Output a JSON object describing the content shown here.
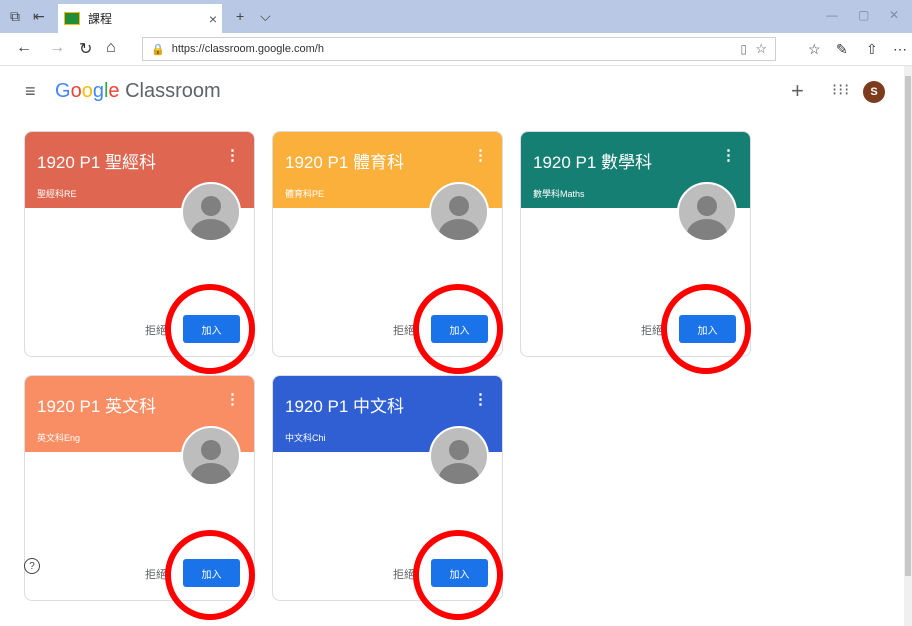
{
  "browser": {
    "tab_title": "課程",
    "url": "https://classroom.google.com/h"
  },
  "app": {
    "logo_google": [
      "G",
      "o",
      "o",
      "g",
      "l",
      "e"
    ],
    "logo_product": "Classroom",
    "avatar_initial": "S"
  },
  "cards": [
    {
      "name": "1920 P1 聖經科",
      "section": "聖經科RE",
      "decline": "拒絕",
      "join": "加入",
      "color": "#df6650"
    },
    {
      "name": "1920 P1 體育科",
      "section": "體育科PE",
      "decline": "拒絕",
      "join": "加入",
      "color": "#fbb03b"
    },
    {
      "name": "1920 P1 數學科",
      "section": "數學科Maths",
      "decline": "拒絕",
      "join": "加入",
      "color": "#167f73"
    },
    {
      "name": "1920 P1 英文科",
      "section": "英文科Eng",
      "decline": "拒絕",
      "join": "加入",
      "color": "#f98e64"
    },
    {
      "name": "1920 P1 中文科",
      "section": "中文科Chi",
      "decline": "拒絕",
      "join": "加入",
      "color": "#2f5fd3"
    }
  ],
  "help": "?"
}
